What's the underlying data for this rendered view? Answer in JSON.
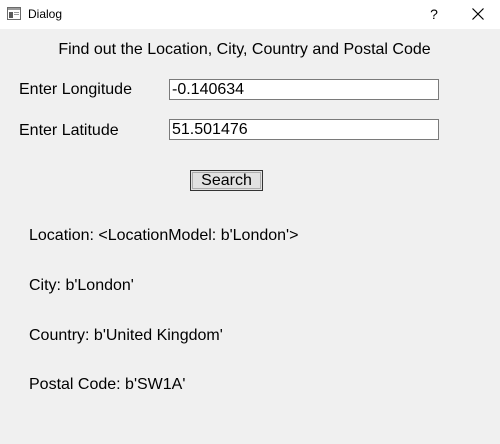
{
  "window": {
    "title": "Dialog",
    "help_label": "?",
    "icons": {
      "app": "dialog-app-icon",
      "close": "close-icon"
    }
  },
  "form": {
    "heading": "Find out the Location, City, Country and Postal Code",
    "longitude_label": "Enter Longitude",
    "longitude_value": "-0.140634",
    "latitude_label": "Enter Latitude",
    "latitude_value": "51.501476",
    "search_label": "Search"
  },
  "results": {
    "location": "Location: <LocationModel: b'London'>",
    "city": "City: b'London'",
    "country": "Country: b'United Kingdom'",
    "postal_code": "Postal Code: b'SW1A'"
  }
}
